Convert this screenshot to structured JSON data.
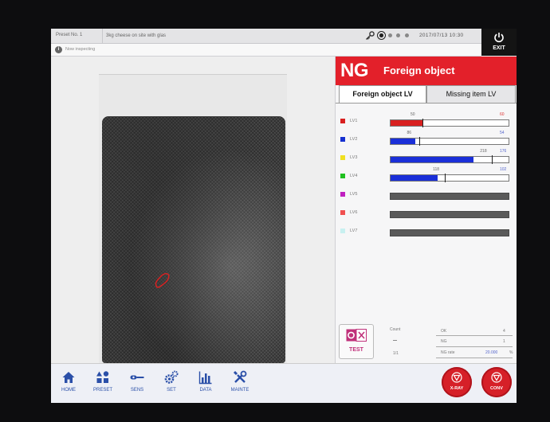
{
  "topbar": {
    "preset_no": "Preset No. 1",
    "preset_name": "3kg cheese on site with glas",
    "datetime": "2017/07/13  10:30",
    "exit_label": "EXIT"
  },
  "status": {
    "message": "Now inspecting"
  },
  "result": {
    "code": "NG",
    "reason": "Foreign object"
  },
  "tabs": [
    {
      "label": "Foreign object LV",
      "active": true
    },
    {
      "label": "Missing item LV",
      "active": false
    }
  ],
  "levels": [
    {
      "name": "LV1",
      "color": "#d82020",
      "value": "50",
      "threshold": "60",
      "fill_fraction": 0.27,
      "marker_fraction": 0.27,
      "fill_color": "#d82020",
      "threshold_color": "red",
      "enabled": true
    },
    {
      "name": "LV2",
      "color": "#1630d0",
      "value": "86",
      "threshold": "54",
      "fill_fraction": 0.21,
      "marker_fraction": 0.24,
      "fill_color": "#1a2fd8",
      "threshold_color": "blue",
      "enabled": true
    },
    {
      "name": "LV3",
      "color": "#f0e020",
      "value": "218",
      "threshold": "176",
      "fill_fraction": 0.7,
      "marker_fraction": 0.86,
      "fill_color": "#1a2fd8",
      "threshold_color": "blue",
      "enabled": true
    },
    {
      "name": "LV4",
      "color": "#20c020",
      "value": "118",
      "threshold": "102",
      "fill_fraction": 0.4,
      "marker_fraction": 0.46,
      "fill_color": "#1a2fd8",
      "threshold_color": "blue",
      "enabled": true
    },
    {
      "name": "LV5",
      "color": "#c020c0",
      "enabled": false
    },
    {
      "name": "LV6",
      "color": "#f05050",
      "enabled": false
    },
    {
      "name": "LV7",
      "color": "#c8f0f0",
      "enabled": false
    }
  ],
  "test": {
    "label": "TEST"
  },
  "counts": {
    "count_label": "Count",
    "ok_label": "OK",
    "ok_value": "4",
    "ng_label": "NG",
    "ng_value": "1",
    "ratio": "1/1",
    "ng_rate_label": "NG rate",
    "ng_rate_value": "20.000",
    "ng_rate_unit": "%"
  },
  "nav": [
    {
      "label": "HOME",
      "icon": "home-icon"
    },
    {
      "label": "PRESET",
      "icon": "preset-icon"
    },
    {
      "label": "SENS",
      "icon": "sens-icon"
    },
    {
      "label": "SET",
      "icon": "gears-icon"
    },
    {
      "label": "DATA",
      "icon": "bar-chart-icon"
    },
    {
      "label": "MAINTE",
      "icon": "tools-icon"
    }
  ],
  "actions": {
    "xray_label": "X-RAY",
    "conv_label": "CONV"
  },
  "colors": {
    "accent": "#e3202a",
    "nav_text": "#2a4fa8"
  }
}
